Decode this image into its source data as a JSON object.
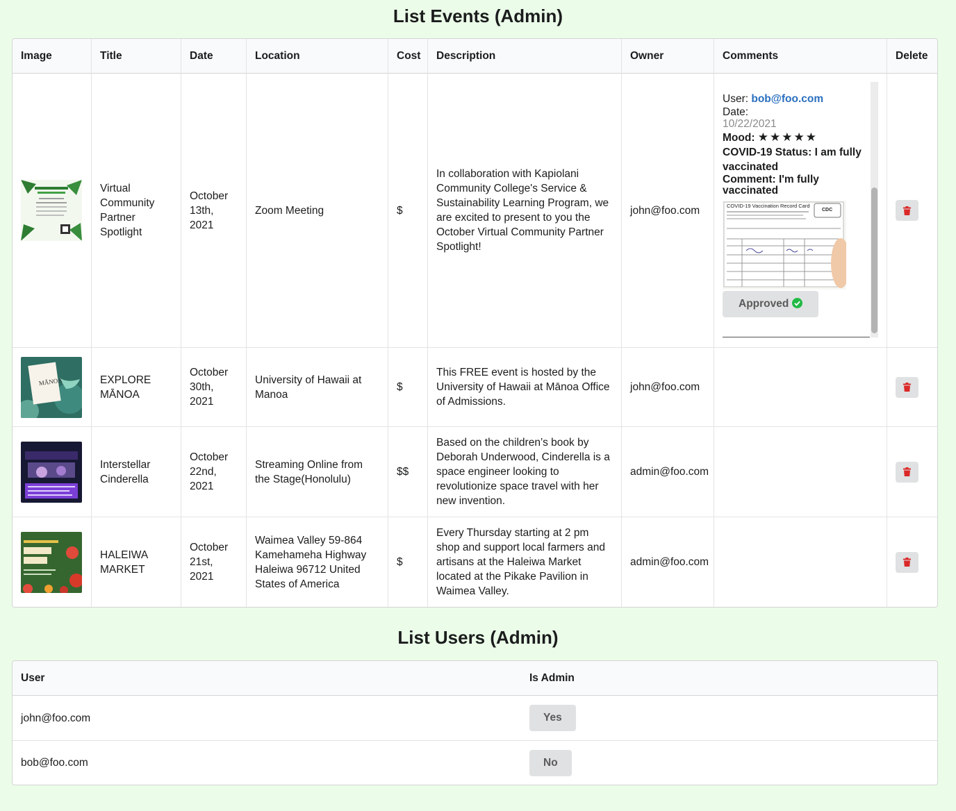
{
  "events_section": {
    "title": "List Events (Admin)",
    "columns": [
      "Image",
      "Title",
      "Date",
      "Location",
      "Cost",
      "Description",
      "Owner",
      "Comments",
      "Delete"
    ],
    "rows": [
      {
        "image": "Virtual Community Partner Spotlight flyer",
        "title": "Virtual Community Partner Spotlight",
        "date": "October 13th, 2021",
        "location": "Zoom Meeting",
        "cost": "$",
        "description": "In collaboration with Kapiolani Community College's Service & Sustainability Learning Program, we are excited to present to you the October Virtual Community Partner Spotlight!",
        "owner": "john@foo.com"
      },
      {
        "image": "Explore Manoa flyer",
        "title": "EXPLORE MĀNOA",
        "date": "October 30th, 2021",
        "location": "University of Hawaii at Manoa",
        "cost": "$",
        "description": "This FREE event is hosted by the University of Hawaii at Mānoa Office of Admissions.",
        "owner": "john@foo.com"
      },
      {
        "image": "Interstellar Cinderella flyer",
        "title": "Interstellar Cinderella",
        "date": "October 22nd, 2021",
        "location": "Streaming Online from the Stage(Honolulu)",
        "cost": "$$",
        "description": "Based on the children’s book by Deborah Underwood, Cinderella is a space engineer looking to revolutionize space travel with her new invention.",
        "owner": "admin@foo.com"
      },
      {
        "image": "Haleiwa Farmers Market flyer",
        "title": "HALEIWA MARKET",
        "date": "October 21st, 2021",
        "location": "Waimea Valley 59-864 Kamehameha Highway Haleiwa 96712 United States of America",
        "cost": "$",
        "description": "Every Thursday starting at 2 pm shop and support local farmers and artisans at the Haleiwa Market located at the Pikake Pavilion in Waimea Valley.",
        "owner": "admin@foo.com"
      }
    ],
    "comment": {
      "user_label": "User:",
      "user": "bob@foo.com",
      "date_label": "Date:",
      "date": "10/22/2021",
      "mood_label": "Mood:",
      "mood_stars": 5,
      "covid_status": "COVID-19 Status: I am fully vaccinated",
      "comment_text": "Comment: I'm fully vaccinated",
      "card_title": "COVID-19 Vaccination Record Card",
      "card_logo": "CDC",
      "approved_label": "Approved"
    }
  },
  "users_section": {
    "title": "List Users (Admin)",
    "columns": [
      "User",
      "Is Admin"
    ],
    "rows": [
      {
        "user": "john@foo.com",
        "is_admin": "Yes"
      },
      {
        "user": "bob@foo.com",
        "is_admin": "No"
      }
    ]
  },
  "colors": {
    "page_bg": "#ebfde9",
    "link": "#2a6fbf",
    "delete_icon": "#db2828",
    "approved_check": "#21ba45"
  },
  "icons": {
    "delete": "trash-icon",
    "approved": "check-circle-icon",
    "mood": "star-icon"
  }
}
